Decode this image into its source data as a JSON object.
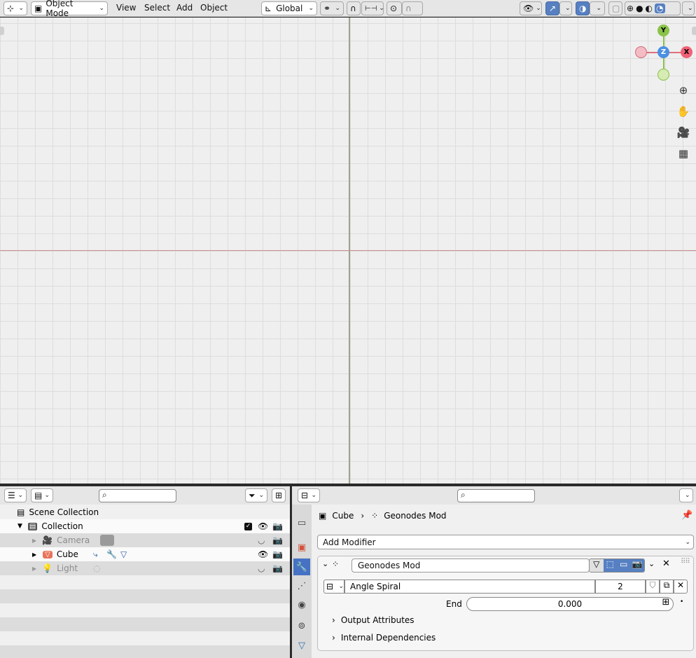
{
  "header": {
    "mode": "Object Mode",
    "menus": [
      "View",
      "Select",
      "Add",
      "Object"
    ],
    "orientation": "Global"
  },
  "gizmo": {
    "y": "Y",
    "x": "X",
    "z": "Z"
  },
  "outliner": {
    "scene_collection": "Scene Collection",
    "collection": "Collection",
    "items": [
      "Camera",
      "Cube",
      "Light"
    ]
  },
  "properties": {
    "breadcrumb_object": "Cube",
    "breadcrumb_modifier": "Geonodes Mod",
    "add_modifier": "Add Modifier",
    "modifier_name": "Geonodes Mod",
    "node_group": "Angle Spiral",
    "node_group_users": "2",
    "end_label": "End",
    "end_value": "0.000",
    "output_attributes": "Output Attributes",
    "internal_dependencies": "Internal Dependencies"
  },
  "colors": {
    "accent": "#5680c2",
    "x_axis": "#cc8e8e",
    "y_axis": "#9fa28e"
  }
}
